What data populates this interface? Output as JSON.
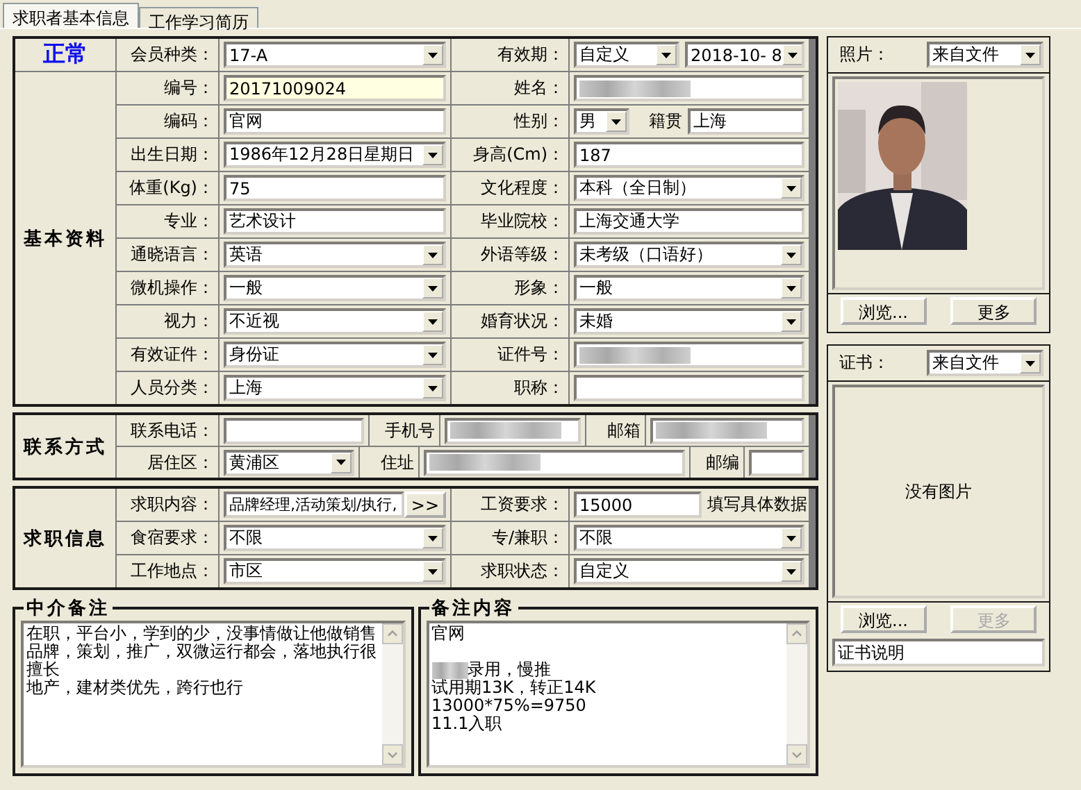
{
  "tabs": [
    {
      "label": "求职者基本信息",
      "selected": true
    },
    {
      "label": "工作学习简历",
      "selected": false
    }
  ],
  "status": "正常",
  "member_type": {
    "label": "会员种类：",
    "kind": "select",
    "value": "17-A",
    "highlighted": false
  },
  "validity": {
    "label": "有效期：",
    "mode": "自定义",
    "date": "2018-10- 8"
  },
  "basic": {
    "title": "基本资料",
    "rows": [
      {
        "left": {
          "label": "编号：",
          "kind": "text",
          "value": "20171009024",
          "highlighted": true
        },
        "right": {
          "label": "姓名：",
          "kind": "blurred",
          "highlighted": false
        }
      },
      {
        "left": {
          "label": "编码：",
          "kind": "text",
          "value": "官网",
          "highlighted": false
        },
        "right": {
          "label": "性别：",
          "kind": "gender",
          "value": "男",
          "origin_label": "籍贯",
          "origin": "上海",
          "highlighted": false
        }
      },
      {
        "left": {
          "label": "出生日期：",
          "kind": "select",
          "value": "1986年12月28日星期日",
          "highlighted": false
        },
        "right": {
          "label": "身高(Cm)：",
          "kind": "text",
          "value": "187",
          "highlighted": false
        }
      },
      {
        "left": {
          "label": "体重(Kg)：",
          "kind": "text",
          "value": "75",
          "highlighted": false
        },
        "right": {
          "label": "文化程度：",
          "kind": "select",
          "value": "本科（全日制）",
          "highlighted": false
        }
      },
      {
        "left": {
          "label": "专业：",
          "kind": "text",
          "value": "艺术设计",
          "highlighted": false
        },
        "right": {
          "label": "毕业院校：",
          "kind": "text",
          "value": "上海交通大学",
          "highlighted": false
        }
      },
      {
        "left": {
          "label": "通晓语言：",
          "kind": "select",
          "value": "英语",
          "highlighted": false
        },
        "right": {
          "label": "外语等级：",
          "kind": "select",
          "value": "未考级（口语好）",
          "highlighted": false
        }
      },
      {
        "left": {
          "label": "微机操作：",
          "kind": "select",
          "value": "一般",
          "highlighted": false
        },
        "right": {
          "label": "形象：",
          "kind": "select",
          "value": "一般",
          "highlighted": false
        }
      },
      {
        "left": {
          "label": "视力：",
          "kind": "select",
          "value": "不近视",
          "highlighted": false
        },
        "right": {
          "label": "婚育状况：",
          "kind": "select",
          "value": "未婚",
          "highlighted": false
        }
      },
      {
        "left": {
          "label": "有效证件：",
          "kind": "select",
          "value": "身份证",
          "highlighted": false
        },
        "right": {
          "label": "证件号：",
          "kind": "blurred",
          "highlighted": false
        }
      },
      {
        "left": {
          "label": "人员分类：",
          "kind": "select",
          "value": "上海",
          "highlighted": false
        },
        "right": {
          "label": "职称：",
          "kind": "text",
          "highlighted": false
        }
      }
    ]
  },
  "contact": {
    "title": "联系方式",
    "phone": {
      "label": "联系电话：",
      "kind": "text",
      "highlighted": false
    },
    "mobile": {
      "label": "手机号",
      "kind": "blurred",
      "highlighted": false
    },
    "email": {
      "label": "邮箱",
      "kind": "blurred",
      "highlighted": false
    },
    "district": {
      "label": "居住区：",
      "kind": "select",
      "value": "黄浦区",
      "highlighted": false
    },
    "address": {
      "label": "住址",
      "kind": "blurred",
      "highlighted": false
    },
    "postcode": {
      "label": "邮编",
      "kind": "text",
      "highlighted": false
    }
  },
  "job": {
    "title": "求职信息",
    "rows": [
      {
        "left": {
          "label": "求职内容：",
          "kind": "picker",
          "value": "品牌经理,活动策划/执行,",
          "button": ">>",
          "highlighted": false
        },
        "right": {
          "label": "工资要求：",
          "kind": "hint",
          "value": "15000",
          "hint": "填写具体数据",
          "highlighted": false
        }
      },
      {
        "left": {
          "label": "食宿要求：",
          "kind": "select",
          "value": "不限",
          "highlighted": false
        },
        "right": {
          "label": "专/兼职：",
          "kind": "select",
          "value": "不限",
          "highlighted": false
        }
      },
      {
        "left": {
          "label": "工作地点：",
          "kind": "select",
          "value": "市区",
          "highlighted": false
        },
        "right": {
          "label": "求职状态：",
          "kind": "select",
          "value": "自定义",
          "highlighted": false
        }
      }
    ]
  },
  "notes": [
    {
      "title": "中介备注",
      "lines": [
        {
          "kind": "text",
          "text": "在职，平台小，学到的少，没事情做让他做销售"
        },
        {
          "kind": "text",
          "text": "品牌，策划，推广，双微运行都会，落地执行很"
        },
        {
          "kind": "text",
          "text": "擅长"
        },
        {
          "kind": "text",
          "text": "地产，建材类优先，跨行也行"
        }
      ]
    },
    {
      "title": "备注内容",
      "lines": [
        {
          "kind": "text",
          "text": "官网"
        },
        {
          "kind": "blank"
        },
        {
          "kind": "blurred_prefix",
          "text": "录用，慢推"
        },
        {
          "kind": "text",
          "text": "试用期13K，转正14K"
        },
        {
          "kind": "text",
          "text": "13000*75%=9750"
        },
        {
          "kind": "text",
          "text": "11.1入职"
        }
      ]
    }
  ],
  "photo": {
    "label": "照片：",
    "source": "来自文件",
    "kind": "picture",
    "buttons": [
      {
        "label": "浏览...",
        "disabled": false
      },
      {
        "label": "更多",
        "disabled": false
      }
    ]
  },
  "certificate": {
    "label": "证书：",
    "source": "来自文件",
    "empty_text": "没有图片",
    "buttons": [
      {
        "label": "浏览...",
        "disabled": false
      },
      {
        "label": "更多",
        "disabled": true
      }
    ],
    "caption": "证书说明"
  }
}
